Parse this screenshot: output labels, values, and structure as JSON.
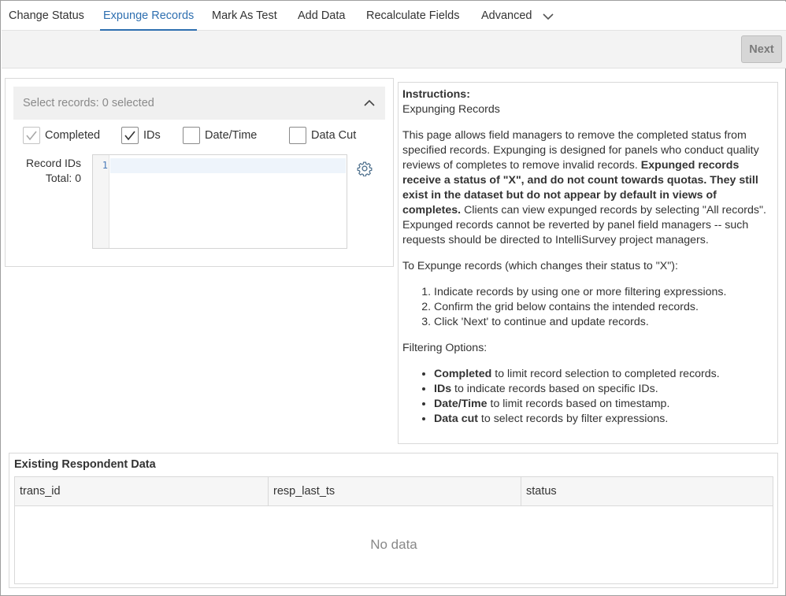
{
  "tabs": [
    {
      "label": "Change Status"
    },
    {
      "label": "Expunge Records"
    },
    {
      "label": "Mark As Test"
    },
    {
      "label": "Add Data"
    },
    {
      "label": "Recalculate Fields"
    },
    {
      "label": "Advanced"
    }
  ],
  "active_tab": "Expunge Records",
  "toolbar": {
    "next_label": "Next"
  },
  "selector": {
    "header": "Select records: 0 selected",
    "filters": [
      {
        "label": "Completed",
        "checked": true,
        "disabled": true
      },
      {
        "label": "IDs",
        "checked": true,
        "disabled": false
      },
      {
        "label": "Date/Time",
        "checked": false,
        "disabled": false
      },
      {
        "label": "Data Cut",
        "checked": false,
        "disabled": false
      }
    ],
    "record_ids_label": "Record IDs",
    "total_label": "Total: 0",
    "editor_line": "1",
    "icons": {
      "collapse": "chevron-up-icon",
      "settings": "gear-icon"
    }
  },
  "instructions": {
    "heading": "Instructions:",
    "subheading": "Expunging Records",
    "para1_a": "This page allows field managers to remove the completed status from specified records. Expunging is designed for panels who conduct quality reviews of completes to remove invalid records. ",
    "para1_b": "Expunged records receive a status of \"X\", and do not count towards quotas. They still exist in the dataset but do not appear by default in views of completes.",
    "para1_c": " Clients can view expunged records by selecting \"All records\". Expunged records cannot be reverted by panel field managers -- such requests should be directed to IntelliSurvey project managers.",
    "para2": "To Expunge records (which changes their status to \"X\"):",
    "steps": [
      "Indicate records by using one or more filtering expressions.",
      "Confirm the grid below contains the intended records.",
      "Click 'Next' to continue and update records."
    ],
    "filtering_heading": "Filtering Options:",
    "options": [
      {
        "term": "Completed",
        "desc": " to limit record selection to completed records."
      },
      {
        "term": "IDs",
        "desc": " to indicate records based on specific IDs."
      },
      {
        "term": "Date/Time",
        "desc": " to limit records based on timestamp."
      },
      {
        "term": "Data cut",
        "desc": " to select records by filter expressions."
      }
    ]
  },
  "existing_data": {
    "title": "Existing Respondent Data",
    "columns": [
      "trans_id",
      "resp_last_ts",
      "status"
    ],
    "empty_text": "No data"
  },
  "colors": {
    "accent": "#2e6fb0"
  }
}
